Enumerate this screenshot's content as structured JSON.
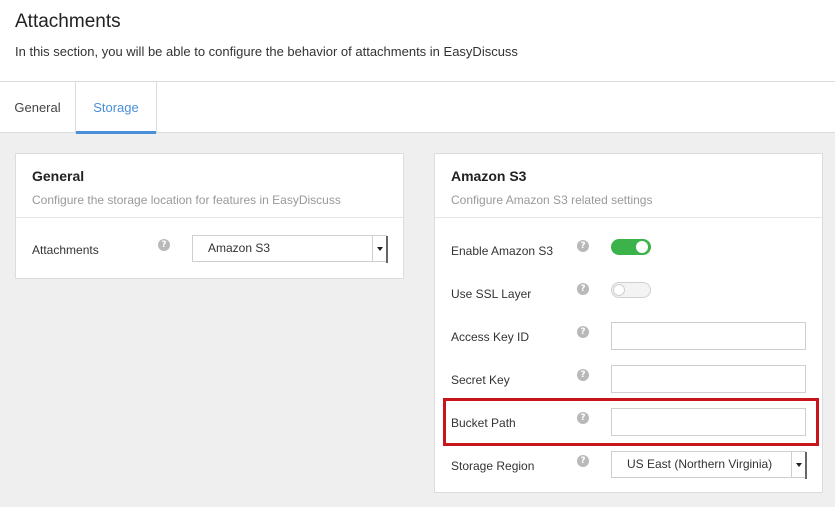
{
  "header": {
    "title": "Attachments",
    "description": "In this section, you will be able to configure the behavior of attachments in EasyDiscuss"
  },
  "tabs": [
    {
      "label": "General",
      "active": false
    },
    {
      "label": "Storage",
      "active": true
    }
  ],
  "general_panel": {
    "title": "General",
    "subtitle": "Configure the storage location for features in EasyDiscuss",
    "attachments": {
      "label": "Attachments",
      "value": "Amazon S3"
    }
  },
  "s3_panel": {
    "title": "Amazon S3",
    "subtitle": "Configure Amazon S3 related settings",
    "enable": {
      "label": "Enable Amazon S3",
      "on": true
    },
    "ssl": {
      "label": "Use SSL Layer",
      "on": false
    },
    "access_key": {
      "label": "Access Key ID",
      "value": ""
    },
    "secret_key": {
      "label": "Secret Key",
      "value": ""
    },
    "bucket_path": {
      "label": "Bucket Path",
      "value": ""
    },
    "region": {
      "label": "Storage Region",
      "value": "US East (Northern Virginia)"
    }
  },
  "icons": {
    "help": "question-circle-icon",
    "caret": "caret-down-icon"
  },
  "colors": {
    "accent": "#4a90d9",
    "toggle_on": "#3cb34a",
    "highlight": "#c8141b"
  }
}
